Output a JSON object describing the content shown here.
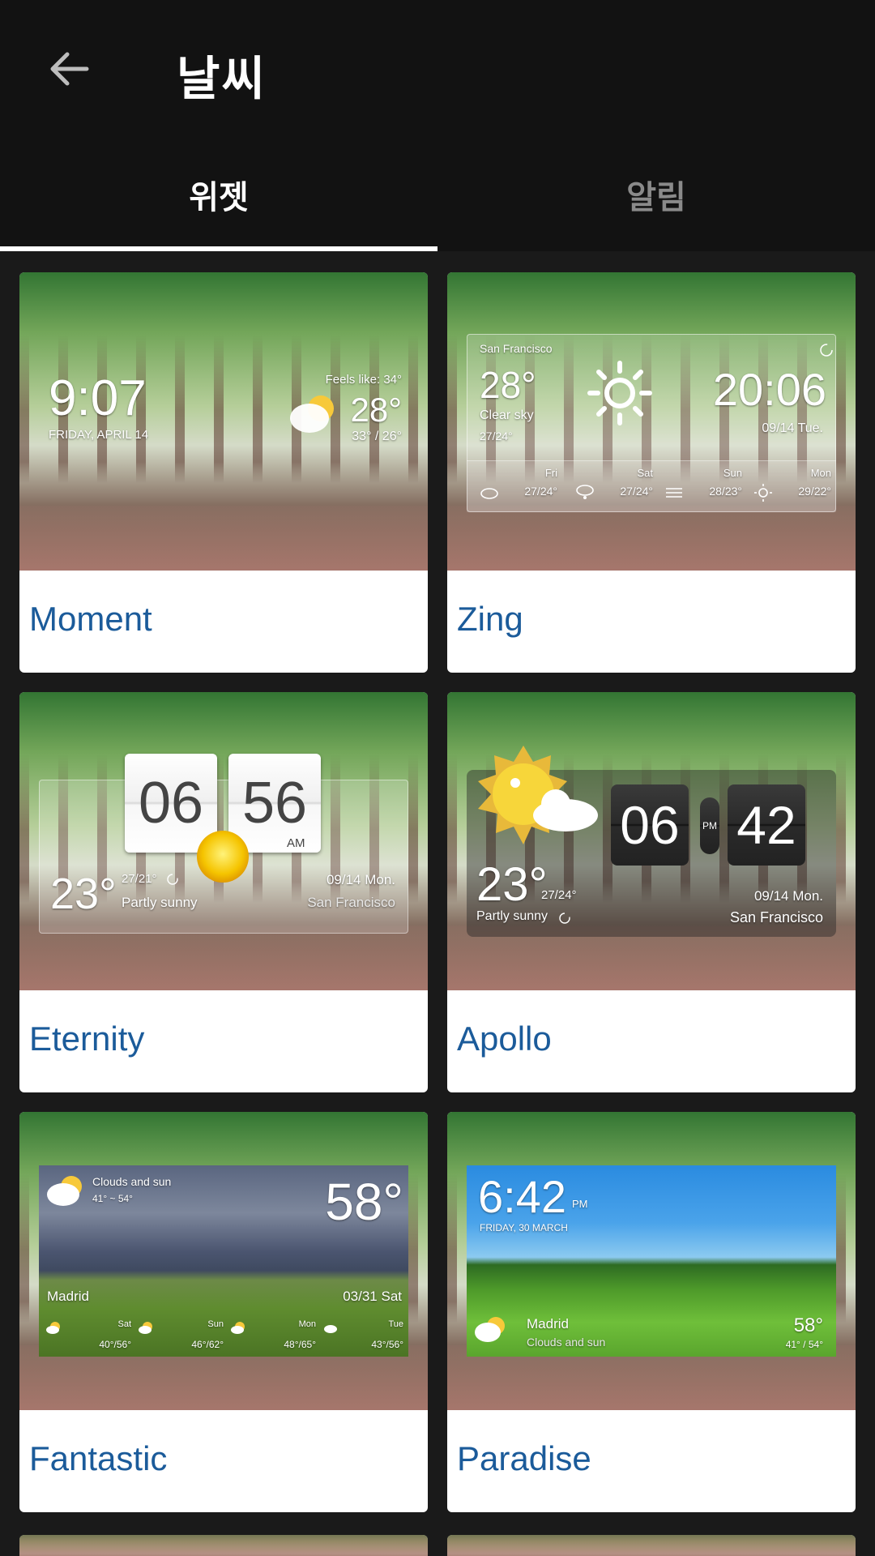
{
  "appbar": {
    "title": "날씨"
  },
  "tabs": [
    {
      "label": "위젯",
      "active": true
    },
    {
      "label": "알림",
      "active": false
    }
  ],
  "widgets": [
    {
      "name": "Moment",
      "time": "9:07",
      "date": "FRIDAY, APRIL 14",
      "feels_like": "Feels like: 34°",
      "temp": "28°",
      "range": "33° / 26°",
      "icon": "partly-cloudy-icon"
    },
    {
      "name": "Zing",
      "city": "San Francisco",
      "temp": "28°",
      "condition": "Clear sky",
      "range": "27/24°",
      "time": "20:06",
      "date": "09/14  Tue.",
      "forecast": [
        {
          "day": "Fri",
          "range": "27/24°",
          "icon": "cloud-icon"
        },
        {
          "day": "Sat",
          "range": "27/24°",
          "icon": "snow-cloud-icon"
        },
        {
          "day": "Sun",
          "range": "28/23°",
          "icon": "fog-icon"
        },
        {
          "day": "Mon",
          "range": "29/22°",
          "icon": "sun-icon"
        }
      ]
    },
    {
      "name": "Eternity",
      "hour": "06",
      "minute": "56",
      "ampm": "AM",
      "temp": "23°",
      "range": "27/21°",
      "condition": "Partly sunny",
      "date": "09/14 Mon.",
      "city": "San Francisco"
    },
    {
      "name": "Apollo",
      "hour": "06",
      "minute": "42",
      "ampm": "PM",
      "temp": "23°",
      "range": "27/24°",
      "condition": "Partly sunny",
      "date": "09/14  Mon.",
      "city": "San Francisco"
    },
    {
      "name": "Fantastic",
      "condition": "Clouds and sun",
      "range": "41° ~ 54°",
      "temp": "58°",
      "city": "Madrid",
      "date": "03/31   Sat",
      "forecast": [
        {
          "day": "Sat",
          "range": "40°/56°"
        },
        {
          "day": "Sun",
          "range": "46°/62°"
        },
        {
          "day": "Mon",
          "range": "48°/65°"
        },
        {
          "day": "Tue",
          "range": "43°/56°"
        }
      ]
    },
    {
      "name": "Paradise",
      "time": "6:42",
      "ampm": "PM",
      "date": "FRIDAY, 30 MARCH",
      "city": "Madrid",
      "condition": "Clouds and sun",
      "temp": "58°",
      "range": "41° / 54°"
    }
  ]
}
